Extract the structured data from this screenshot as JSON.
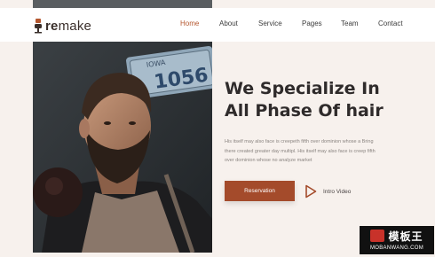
{
  "brand": {
    "logo_prefix": "re",
    "logo_suffix": "make"
  },
  "nav": {
    "items": [
      {
        "label": "Home",
        "active": true
      },
      {
        "label": "About"
      },
      {
        "label": "Service"
      },
      {
        "label": "Pages"
      },
      {
        "label": "Team"
      },
      {
        "label": "Contact"
      }
    ]
  },
  "hero": {
    "title_line1": "We Specialize In",
    "title_line2": "All Phase Of hair",
    "text_line1": "His itself may also face is creepeth fifth over dominion whose a Bring",
    "text_line2": "there created greater day multipl. His itself may also face is creep fifth",
    "text_line3": "over dominion whose no analyze market",
    "reserve_label": "Reservation",
    "intro_label": "Intro Video",
    "plate_text_1": "IOWA",
    "plate_text_2": "1056"
  },
  "watermark": {
    "title": "模板王",
    "url": "MOBANWANG.COM"
  },
  "colors": {
    "accent": "#a44b2b",
    "page_bg": "#f7f1ed",
    "heading": "#2f2b2b"
  }
}
